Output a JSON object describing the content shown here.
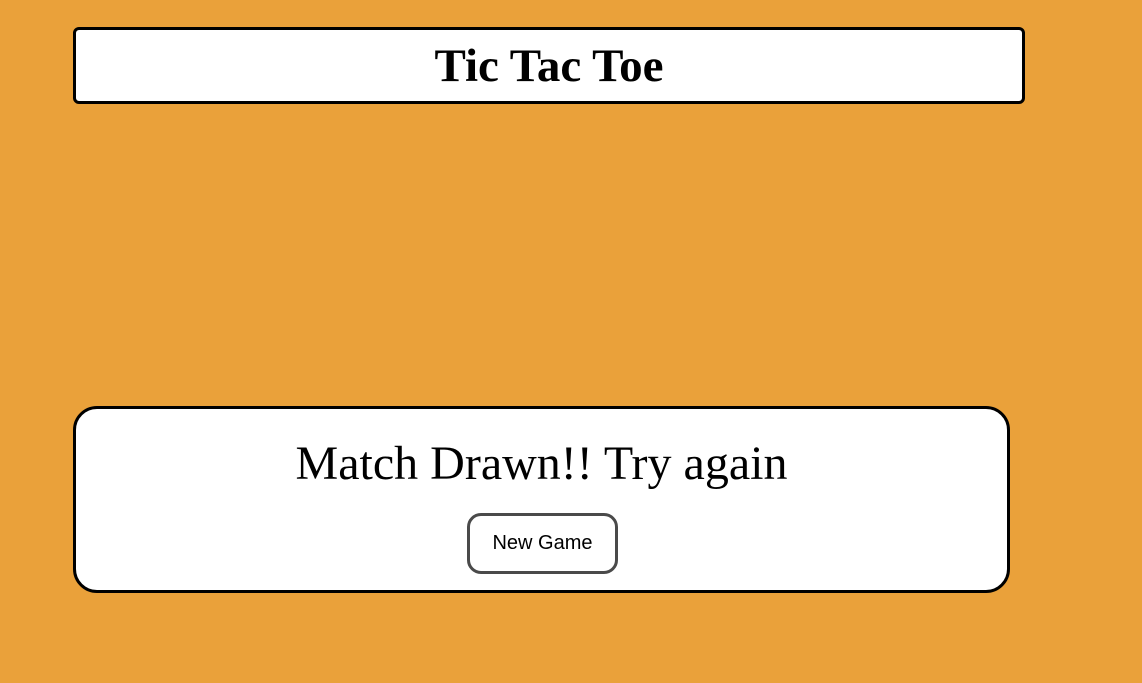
{
  "header": {
    "title": "Tic Tac Toe"
  },
  "result": {
    "message": "Match Drawn!! Try again",
    "new_game_label": "New Game"
  },
  "colors": {
    "background": "#eaa13a",
    "panel": "#ffffff",
    "border": "#000000"
  }
}
